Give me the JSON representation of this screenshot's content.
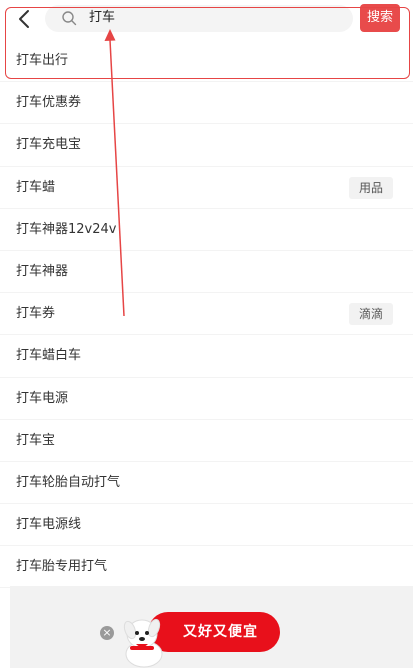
{
  "search": {
    "query": "打车",
    "button_label": "搜索"
  },
  "suggestions": [
    {
      "label": "打车出行",
      "tag": ""
    },
    {
      "label": "打车优惠券",
      "tag": ""
    },
    {
      "label": "打车充电宝",
      "tag": ""
    },
    {
      "label": "打车蜡",
      "tag": "用品"
    },
    {
      "label": "打车神器12v24v",
      "tag": ""
    },
    {
      "label": "打车神器",
      "tag": ""
    },
    {
      "label": "打车券",
      "tag": "滴滴"
    },
    {
      "label": "打车蜡白车",
      "tag": ""
    },
    {
      "label": "打车电源",
      "tag": ""
    },
    {
      "label": "打车宝",
      "tag": ""
    },
    {
      "label": "打车轮胎自动打气",
      "tag": ""
    },
    {
      "label": "打车电源线",
      "tag": ""
    },
    {
      "label": "打车胎专用打气",
      "tag": ""
    }
  ],
  "promo": {
    "text": "又好又便宜",
    "close_symbol": "×"
  },
  "colors": {
    "accent": "#e84b4b",
    "annotation": "#e64545",
    "promo": "#e8101b"
  }
}
